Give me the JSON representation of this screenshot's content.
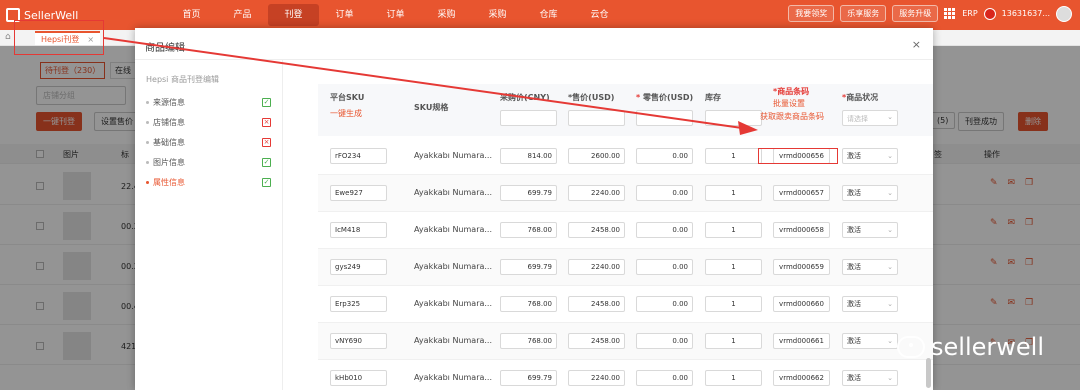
{
  "brand": {
    "name": "SellerWell"
  },
  "nav": {
    "items": [
      "首页",
      "产品",
      "刊登",
      "订单",
      "订单",
      "采购",
      "采购",
      "仓库",
      "云仓"
    ],
    "right": {
      "promo": "我要领奖",
      "service": "乐享服务",
      "upgrade": "服务升级",
      "erp": "ERP",
      "phone": "13631637..."
    }
  },
  "tabbar": {
    "tab_label": "Hepsi刊登",
    "close": "×"
  },
  "background": {
    "subtabs": [
      "待刊登（230）",
      "在线"
    ],
    "filter_placeholder": "店铺分组",
    "buttons": {
      "publish": "一键刊登",
      "set_price": "设置售价"
    },
    "right_badges": {
      "count": "(5)",
      "status": "刊登成功",
      "delete": "删除"
    },
    "headers": {
      "image": "图片",
      "title": "标",
      "actions": "操作",
      "col": "签"
    },
    "rows": [
      {
        "title": "22.4"
      },
      {
        "title": "00.2"
      },
      {
        "title": "00.2"
      },
      {
        "title": "00.4"
      },
      {
        "title": "421"
      }
    ]
  },
  "modal": {
    "title": "商品编辑",
    "close": "×",
    "side_title": "Hepsi 商品刊登编辑",
    "side_items": [
      {
        "label": "来源信息",
        "status": "ok"
      },
      {
        "label": "店铺信息",
        "status": "bad"
      },
      {
        "label": "基础信息",
        "status": "bad"
      },
      {
        "label": "图片信息",
        "status": "ok"
      },
      {
        "label": "属性信息",
        "status": "ok"
      }
    ],
    "table": {
      "headers": {
        "platform_sku": "平台SKU",
        "generate": "一键生成",
        "sku_spec": "SKU规格",
        "purchase_price": "采购价(CNY)",
        "price": "*售价(USD)",
        "retail_price": "零售价(USD)",
        "stock": "库存",
        "barcode": "商品条码",
        "batch_set": "批量设置",
        "fetch_barcode": "获取跟卖商品条码",
        "status": "商品状况",
        "status_placeholder": "请选择"
      },
      "rows": [
        {
          "sku": "rFO234",
          "spec": "Ayakkabı Numara...",
          "purchase": "814.00",
          "price": "2600.00",
          "retail": "0.00",
          "stock": "1",
          "barcode": "vrmd000656",
          "status": "激活"
        },
        {
          "sku": "Ewe927",
          "spec": "Ayakkabı Numara...",
          "purchase": "699.79",
          "price": "2240.00",
          "retail": "0.00",
          "stock": "1",
          "barcode": "vrmd000657",
          "status": "激活"
        },
        {
          "sku": "IcM418",
          "spec": "Ayakkabı Numara...",
          "purchase": "768.00",
          "price": "2458.00",
          "retail": "0.00",
          "stock": "1",
          "barcode": "vrmd000658",
          "status": "激活"
        },
        {
          "sku": "gys249",
          "spec": "Ayakkabı Numara...",
          "purchase": "699.79",
          "price": "2240.00",
          "retail": "0.00",
          "stock": "1",
          "barcode": "vrmd000659",
          "status": "激活"
        },
        {
          "sku": "Erp325",
          "spec": "Ayakkabı Numara...",
          "purchase": "768.00",
          "price": "2458.00",
          "retail": "0.00",
          "stock": "1",
          "barcode": "vrmd000660",
          "status": "激活"
        },
        {
          "sku": "vNY690",
          "spec": "Ayakkabı Numara...",
          "purchase": "768.00",
          "price": "2458.00",
          "retail": "0.00",
          "stock": "1",
          "barcode": "vrmd000661",
          "status": "激活"
        },
        {
          "sku": "kHb010",
          "spec": "Ayakkabı Numara...",
          "purchase": "699.79",
          "price": "2240.00",
          "retail": "0.00",
          "stock": "1",
          "barcode": "vrmd000662",
          "status": "激活"
        }
      ]
    }
  },
  "watermark": {
    "text": "sellerwell"
  },
  "colors": {
    "brand": "#e8552f",
    "annotation": "#e53935"
  }
}
